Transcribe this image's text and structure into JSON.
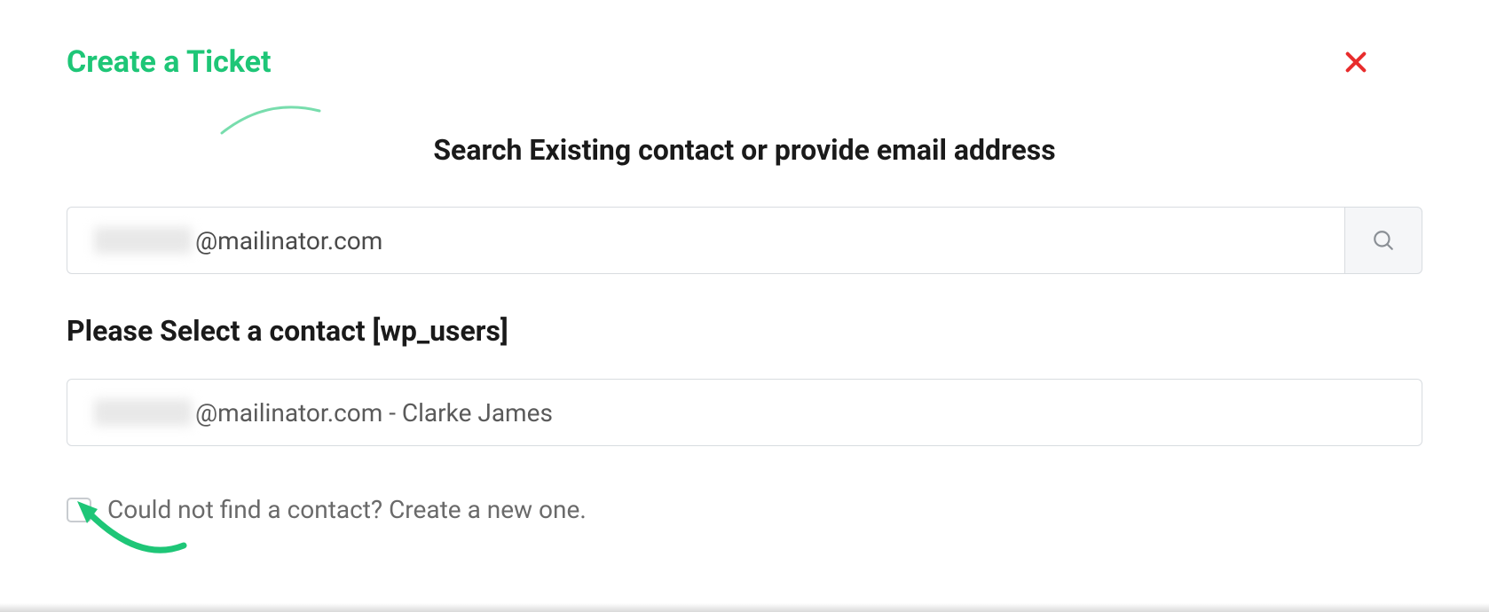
{
  "modal": {
    "title": "Create a Ticket"
  },
  "search": {
    "heading": "Search Existing contact or provide email address",
    "value_suffix": "@mailinator.com"
  },
  "select": {
    "heading": "Please Select a contact [wp_users]",
    "contact_suffix": "@mailinator.com - Clarke James"
  },
  "checkbox": {
    "label": "Could not find a contact? Create a new one."
  },
  "colors": {
    "accent": "#1ec677",
    "close": "#e82c2c"
  }
}
